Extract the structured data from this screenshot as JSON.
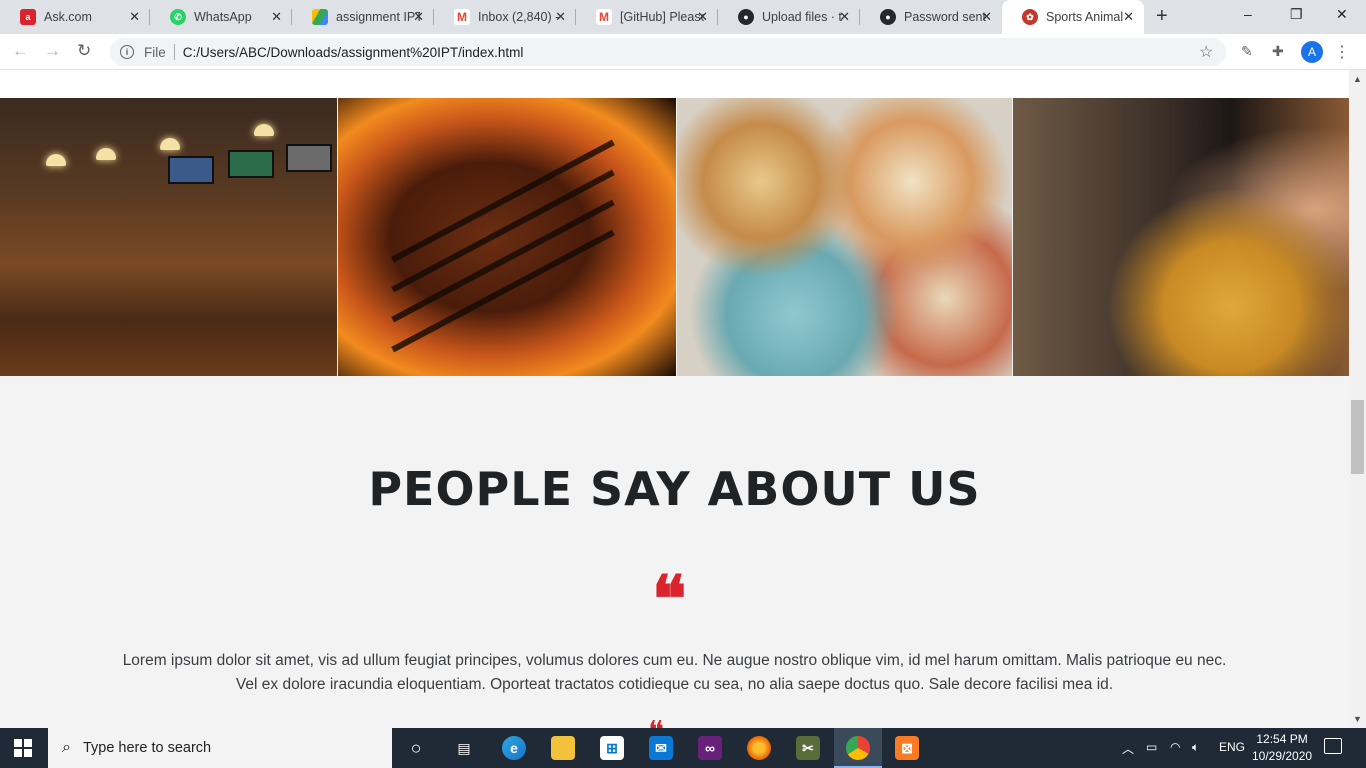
{
  "browser": {
    "tabs": [
      {
        "title": "Ask.com",
        "favicon": "ask",
        "color": "#d9232d"
      },
      {
        "title": "WhatsApp",
        "favicon": "whatsapp",
        "color": "#25d366"
      },
      {
        "title": "assignment IPT",
        "favicon": "google-drive",
        "color": "#34a853"
      },
      {
        "title": "Inbox (2,840) -",
        "favicon": "gmail",
        "color": "#ea4335"
      },
      {
        "title": "[GitHub] Please",
        "favicon": "gmail",
        "color": "#ea4335"
      },
      {
        "title": "Upload files · t",
        "favicon": "github",
        "color": "#24292e"
      },
      {
        "title": "Password sent",
        "favicon": "github",
        "color": "#24292e"
      },
      {
        "title": "Sports Animal",
        "favicon": "sports-animal",
        "color": "#c0392b"
      }
    ],
    "address_scheme": "File",
    "url": "C:/Users/ABC/Downloads/assignment%20IPT/index.html",
    "profile_initial": "A"
  },
  "page": {
    "gallery": [
      {
        "label": "sports-bar-interior"
      },
      {
        "label": "grilled-steak"
      },
      {
        "label": "grilled-food-platter"
      },
      {
        "label": "beer-tap"
      }
    ],
    "testimonial_heading": "PEOPLE SAY ABOUT US",
    "quote_glyph": "❝",
    "testimonial_line1": "Lorem ipsum dolor sit amet, vis ad ullum feugiat principes, volumus dolores cum eu. Ne augue nostro oblique vim, id mel harum omittam. Malis patrioque eu nec.",
    "testimonial_line2": "Vel ex dolore iracundia eloquentiam. Oporteat tractatos cotidieque cu sea, no alia saepe doctus quo. Sale decore facilisi mea id.",
    "accent_color": "#d9232d"
  },
  "taskbar": {
    "search_placeholder": "Type here to search",
    "language": "ENG",
    "time": "12:54 PM",
    "date": "10/29/2020"
  }
}
